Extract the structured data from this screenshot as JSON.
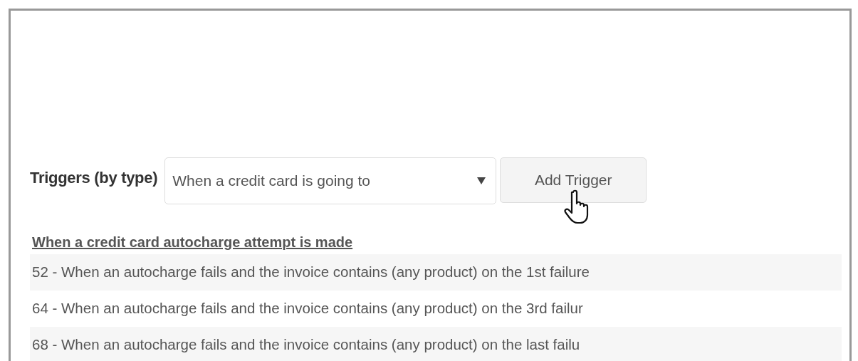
{
  "triggers_label": "Triggers (by type)",
  "trigger_type_select": {
    "value": "When a credit card is going to"
  },
  "add_button": {
    "label": "Add Trigger"
  },
  "section": {
    "heading": "When a credit card autocharge attempt is made",
    "items": [
      "52 - When an autocharge fails and the invoice contains (any product) on the 1st failure",
      "64 - When an autocharge fails and the invoice contains (any product) on the 3rd failur",
      "68 - When an autocharge fails and the invoice contains (any product) on the last failu"
    ]
  }
}
